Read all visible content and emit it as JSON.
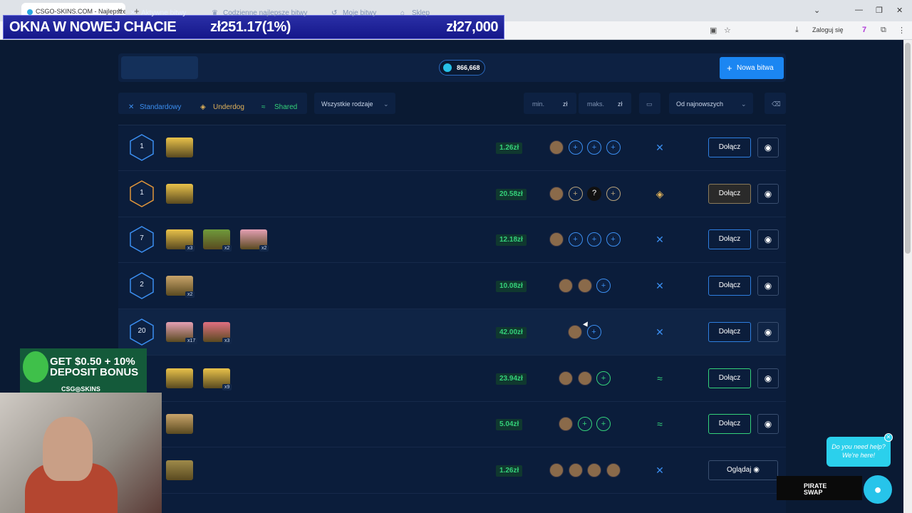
{
  "browser": {
    "tab_title": "CSGO-SKINS.COM - Najlepsze",
    "login": "Zaloguj się"
  },
  "overlay": {
    "left": "OKNA W NOWEJ CHACIE",
    "mid": "zł251.17(1%)",
    "right": "zł27,000"
  },
  "nav": {
    "items": [
      "Aktywne bitwy",
      "Codzienne najlepsze bitwy",
      "Moje bitwy",
      "Sklep"
    ],
    "coins": "866,668",
    "new_battle": "Nowa bitwa"
  },
  "filters": {
    "standard": "Standardowy",
    "underdog": "Underdog",
    "shared": "Shared",
    "all_types": "Wszystkie rodzaje",
    "min": "min.",
    "max": "maks.",
    "currency": "zł",
    "sort": "Od najnowszych"
  },
  "rows": [
    {
      "rounds": "1",
      "price": "1.26zł",
      "join": "Dołącz",
      "mode": "standard",
      "cases": [
        {
          "color": "#e9c24a",
          "mult": ""
        }
      ]
    },
    {
      "rounds": "1",
      "price": "20.58zł",
      "join": "Dołącz",
      "mode": "underdog",
      "cases": [
        {
          "color": "#e9c24a",
          "mult": ""
        }
      ]
    },
    {
      "rounds": "7",
      "price": "12.18zł",
      "join": "Dołącz",
      "mode": "standard",
      "cases": [
        {
          "color": "#e9c24a",
          "mult": "x3"
        },
        {
          "color": "#6f9a3c",
          "mult": "x2"
        },
        {
          "color": "#e4a0b4",
          "mult": "x2"
        }
      ]
    },
    {
      "rounds": "2",
      "price": "10.08zł",
      "join": "Dołącz",
      "mode": "standard",
      "cases": [
        {
          "color": "#c9a46a",
          "mult": "x2"
        }
      ]
    },
    {
      "rounds": "20",
      "price": "42.00zł",
      "join": "Dołącz",
      "mode": "standard",
      "cases": [
        {
          "color": "#e4a0b4",
          "mult": "x17"
        },
        {
          "color": "#e07080",
          "mult": "x3"
        }
      ]
    },
    {
      "rounds": "",
      "price": "23.94zł",
      "join": "Dołącz",
      "mode": "shared",
      "cases": [
        {
          "color": "#e9c24a",
          "mult": ""
        },
        {
          "color": "#e9c24a",
          "mult": "x9"
        }
      ]
    },
    {
      "rounds": "",
      "price": "5.04zł",
      "join": "Dołącz",
      "mode": "shared",
      "cases": [
        {
          "color": "#c9a46a",
          "mult": ""
        }
      ]
    },
    {
      "rounds": "",
      "price": "1.26zł",
      "join": "Oglądaj",
      "mode": "standard",
      "cases": [
        {
          "color": "#9e8a4a",
          "mult": ""
        }
      ]
    }
  ],
  "promo": {
    "line1": "GET $0.50 + 10%",
    "line2": "DEPOSIT BONUS",
    "logo": "CSG◎SKINS"
  },
  "help": {
    "text": "Do you need help? We're here!"
  },
  "pirate": {
    "line1": "PIRATE",
    "line2": "SWAP"
  },
  "colors": {
    "accent": "#1b86f2",
    "price_green": "#34d27a",
    "underdog": "#e0b25a",
    "shared": "#34d27a"
  }
}
